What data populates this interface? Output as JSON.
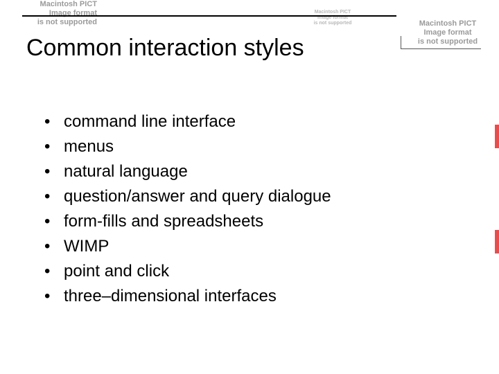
{
  "placeholder_text": {
    "line1": "Macintosh PICT",
    "line2": "Image format",
    "line3": "is not supported"
  },
  "title": "Common interaction styles",
  "bullets": [
    "command line interface",
    "menus",
    "natural language",
    "question/answer and query dialogue",
    "form-fills and spreadsheets",
    "WIMP",
    "point and click",
    "three–dimensional interfaces"
  ]
}
